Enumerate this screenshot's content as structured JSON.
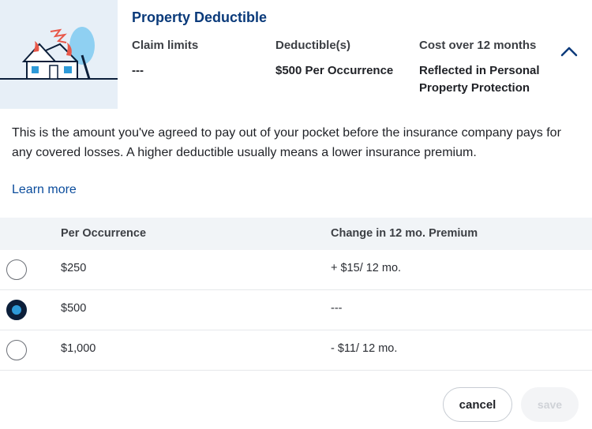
{
  "header": {
    "title": "Property Deductible",
    "columns": [
      {
        "label": "Claim limits",
        "value": "---"
      },
      {
        "label": "Deductible(s)",
        "value": "$500 Per Occurrence"
      },
      {
        "label": "Cost over 12 months",
        "value": "Reflected in Personal Property Protection"
      }
    ]
  },
  "description": "This is the amount you've agreed to pay out of your pocket before the insurance company pays for any covered losses. A higher deductible usually means a lower insurance premium.",
  "learn_more": "Learn more",
  "table": {
    "headers": [
      "Per Occurrence",
      "Change in 12 mo. Premium"
    ],
    "rows": [
      {
        "amount": "$250",
        "change": "+ $15/ 12 mo.",
        "selected": false
      },
      {
        "amount": "$500",
        "change": "---",
        "selected": true
      },
      {
        "amount": "$1,000",
        "change": "- $11/ 12 mo.",
        "selected": false
      }
    ]
  },
  "buttons": {
    "cancel": "cancel",
    "save": "save"
  },
  "colors": {
    "brand": "#0a3a7a",
    "radio_selected": "#2e9ad8",
    "illustration_bg": "#e7eff7"
  },
  "icons": {
    "illustration": "house-fire-illustration",
    "collapse": "chevron-up-icon"
  }
}
